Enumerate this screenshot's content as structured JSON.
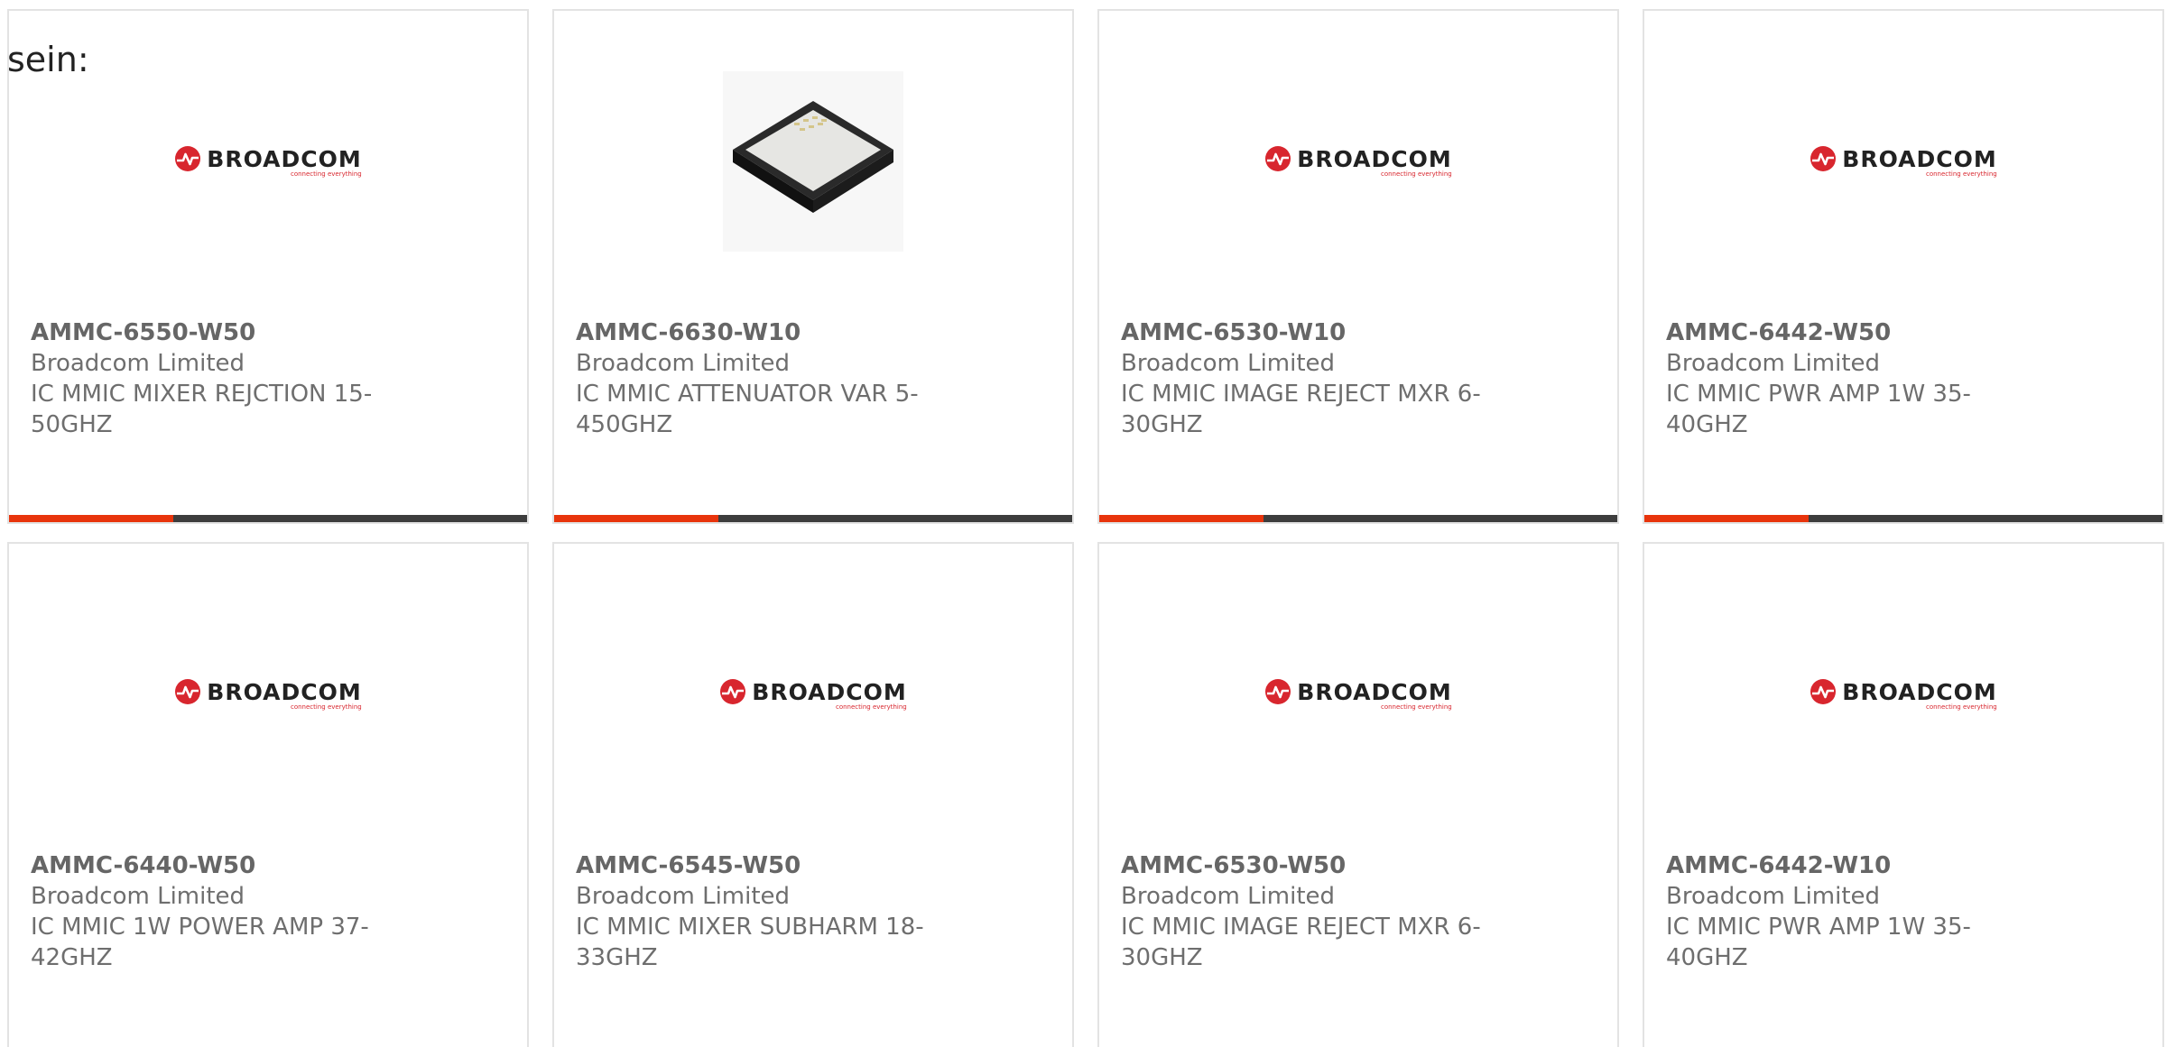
{
  "leading_text": "sein:",
  "brand": {
    "logo_text": "BROADCOM",
    "logo_tagline": "connecting everything",
    "logo_color": "#d8262e",
    "accent_color": "#e8340c",
    "bar_color": "#3d3d3d"
  },
  "products": [
    {
      "part": "AMMC-6550-W50",
      "maker": "Broadcom Limited",
      "desc": "IC MMIC MIXER REJCTION 15-",
      "desc2": "50GHZ",
      "image": "broadcom-logo"
    },
    {
      "part": "AMMC-6630-W10",
      "maker": "Broadcom Limited",
      "desc": "IC MMIC ATTENUATOR VAR 5-",
      "desc2": "450GHZ",
      "image": "chip-photo"
    },
    {
      "part": "AMMC-6530-W10",
      "maker": "Broadcom Limited",
      "desc": "IC MMIC IMAGE REJECT MXR 6-",
      "desc2": "30GHZ",
      "image": "broadcom-logo"
    },
    {
      "part": "AMMC-6442-W50",
      "maker": "Broadcom Limited",
      "desc": "IC MMIC PWR AMP 1W 35-40GHZ",
      "desc2": "",
      "image": "broadcom-logo"
    },
    {
      "part": "AMMC-6440-W50",
      "maker": "Broadcom Limited",
      "desc": "IC MMIC 1W POWER AMP 37-",
      "desc2": "42GHZ",
      "image": "broadcom-logo"
    },
    {
      "part": "AMMC-6545-W50",
      "maker": "Broadcom Limited",
      "desc": "IC MMIC MIXER SUBHARM 18-",
      "desc2": "33GHZ",
      "image": "broadcom-logo"
    },
    {
      "part": "AMMC-6530-W50",
      "maker": "Broadcom Limited",
      "desc": "IC MMIC IMAGE REJECT MXR 6-",
      "desc2": "30GHZ",
      "image": "broadcom-logo"
    },
    {
      "part": "AMMC-6442-W10",
      "maker": "Broadcom Limited",
      "desc": "IC MMIC PWR AMP 1W 35-40GHZ",
      "desc2": "",
      "image": "broadcom-logo"
    }
  ]
}
